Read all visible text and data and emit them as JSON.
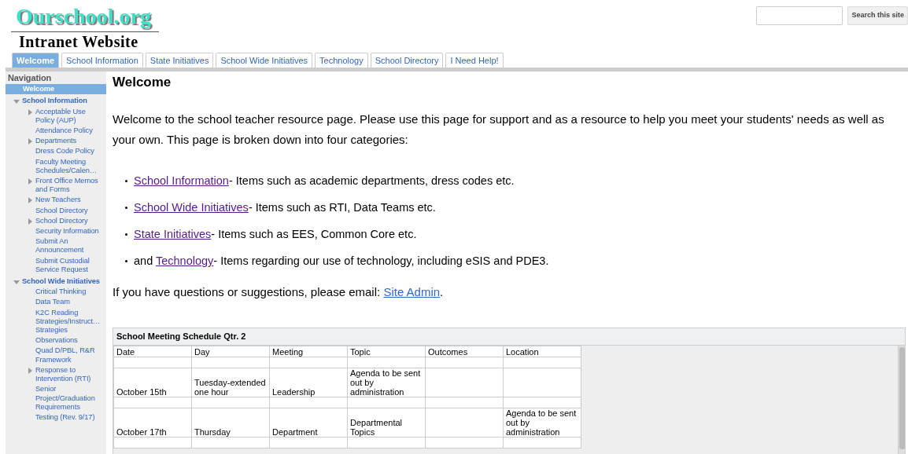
{
  "site": {
    "name": "Ourschool.org",
    "subtitle": "Intranet Website"
  },
  "search": {
    "button": "Search this site"
  },
  "tabs": [
    {
      "label": "Welcome",
      "selected": true
    },
    {
      "label": "School Information",
      "selected": false
    },
    {
      "label": "State Initiatives",
      "selected": false
    },
    {
      "label": "School Wide Initiatives",
      "selected": false
    },
    {
      "label": "Technology",
      "selected": false
    },
    {
      "label": "School Directory",
      "selected": false
    },
    {
      "label": "I Need Help!",
      "selected": false
    }
  ],
  "sidebar": {
    "title": "Navigation",
    "items": [
      {
        "label": "Welcome",
        "kind": "page",
        "selected": true
      },
      {
        "label": "School Information",
        "kind": "expanded",
        "selected": false,
        "children": [
          {
            "label": "Acceptable Use Policy (AUP)",
            "kind": "collapsed",
            "selected": false
          },
          {
            "label": "Attendance Policy",
            "kind": "page",
            "selected": false
          },
          {
            "label": "Departments",
            "kind": "collapsed",
            "selected": false
          },
          {
            "label": "Dress Code Policy",
            "kind": "page",
            "selected": false
          },
          {
            "label": "Faculty Meeting Schedules/Calen…",
            "kind": "page",
            "selected": false
          },
          {
            "label": "Front Office Memos and Forms",
            "kind": "collapsed",
            "selected": false
          },
          {
            "label": "New Teachers",
            "kind": "collapsed",
            "selected": false
          },
          {
            "label": "School Directory",
            "kind": "page",
            "selected": false
          },
          {
            "label": "School Directory",
            "kind": "collapsed",
            "selected": false
          },
          {
            "label": "Security Information",
            "kind": "page",
            "selected": false
          },
          {
            "label": "Submit An Announcement",
            "kind": "page",
            "selected": false
          },
          {
            "label": "Submit Custodial Service Request",
            "kind": "page",
            "selected": false
          }
        ]
      },
      {
        "label": "School Wide Initiatives",
        "kind": "expanded",
        "selected": false,
        "children": [
          {
            "label": "Critical Thinking",
            "kind": "page",
            "selected": false
          },
          {
            "label": "Data Team",
            "kind": "page",
            "selected": false
          },
          {
            "label": "K2C Reading Strategies/Instruct… Strategies",
            "kind": "page",
            "selected": false
          },
          {
            "label": "Observations",
            "kind": "page",
            "selected": false
          },
          {
            "label": "Quad D/PBL, R&R Framework",
            "kind": "page",
            "selected": false
          },
          {
            "label": "Response to Intervention (RTI)",
            "kind": "collapsed",
            "selected": false
          },
          {
            "label": "Senior Project/Graduation Requirements",
            "kind": "page",
            "selected": false
          },
          {
            "label": "Testing (Rev. 9/17)",
            "kind": "page",
            "selected": false
          }
        ]
      }
    ]
  },
  "page": {
    "title": "Welcome",
    "intro": "Welcome to the school teacher resource page.  Please use this page for support and as a resource to help you meet your students' needs as well as your own. This page is broken down into four categories:",
    "bullets": [
      {
        "link": "School Information",
        "visited": true,
        "text": "- Items such as academic departments, dress codes etc."
      },
      {
        "link": "School Wide Initiatives",
        "visited": true,
        "text": "- Items such as RTI, Data Teams etc."
      },
      {
        "link": "State Initiatives",
        "visited": true,
        "text": "- Items such as EES, Common Core etc."
      },
      {
        "prefix": "and ",
        "link": "Technology",
        "visited": true,
        "text": "- Items regarding our use of technology, including eSIS and PDE3."
      }
    ],
    "contact": {
      "text": "If you have questions or suggestions, please email:  ",
      "link": "Site Admin",
      "visited": false,
      "suffix": "."
    }
  },
  "table": {
    "title": "School Meeting Schedule Qtr. 2",
    "columns": [
      "Date",
      "Day",
      "Meeting",
      "Topic",
      "Outcomes",
      "Location"
    ],
    "rows": [
      [
        "",
        "",
        "",
        "",
        "",
        ""
      ],
      [
        "October 15th",
        "Tuesday-extended one hour",
        "Leadership",
        "Agenda to be sent out by administration",
        "",
        ""
      ],
      [
        "",
        "",
        "",
        "",
        "",
        ""
      ],
      [
        "October 17th",
        "Thursday",
        "Department",
        "Departmental Topics",
        "",
        "Agenda to be sent out by administration"
      ],
      [
        "",
        "",
        "",
        "",
        "",
        ""
      ]
    ]
  }
}
